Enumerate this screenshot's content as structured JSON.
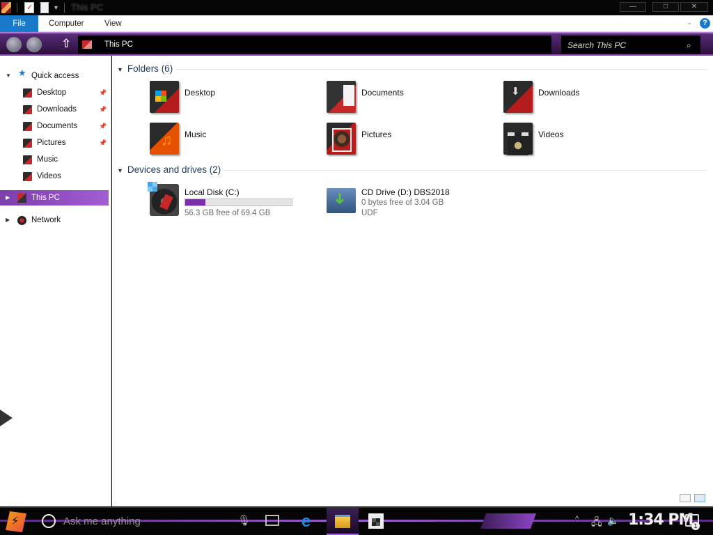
{
  "window": {
    "title": "This PC",
    "controls": {
      "minimize": "—",
      "maximize": "□",
      "close": "✕"
    }
  },
  "ribbon": {
    "tabs": [
      {
        "label": "File",
        "active": true
      },
      {
        "label": "Computer",
        "active": false
      },
      {
        "label": "View",
        "active": false
      }
    ],
    "help": "?"
  },
  "address": {
    "path": "This PC",
    "search_placeholder": "Search This PC"
  },
  "navpane": {
    "quick_access": "Quick access",
    "items": [
      {
        "label": "Desktop",
        "pinned": true,
        "icon": "folder-icon"
      },
      {
        "label": "Downloads",
        "pinned": true,
        "icon": "folder-icon"
      },
      {
        "label": "Documents",
        "pinned": true,
        "icon": "folder-icon"
      },
      {
        "label": "Pictures",
        "pinned": true,
        "icon": "folder-icon"
      },
      {
        "label": "Music",
        "pinned": false,
        "icon": "folder-icon"
      },
      {
        "label": "Videos",
        "pinned": false,
        "icon": "folder-icon"
      }
    ],
    "this_pc": "This PC",
    "network": "Network"
  },
  "content": {
    "folders_header": "Folders (6)",
    "folders": [
      {
        "name": "Desktop",
        "icon": "desktop-folder-icon"
      },
      {
        "name": "Documents",
        "icon": "documents-folder-icon"
      },
      {
        "name": "Downloads",
        "icon": "downloads-folder-icon"
      },
      {
        "name": "Music",
        "icon": "music-folder-icon"
      },
      {
        "name": "Pictures",
        "icon": "pictures-folder-icon"
      },
      {
        "name": "Videos",
        "icon": "videos-folder-icon"
      }
    ],
    "drives_header": "Devices and drives (2)",
    "drives": [
      {
        "name": "Local Disk (C:)",
        "free": "56.3 GB free of 69.4 GB",
        "used_fraction": 0.19,
        "icon": "local-disk-icon"
      },
      {
        "name": "CD Drive (D:) DBS2018",
        "free": "0 bytes free of 3.04 GB",
        "fs": "UDF",
        "icon": "cd-drive-icon"
      }
    ]
  },
  "taskbar": {
    "search_placeholder": "Ask me anything",
    "time": "1:34 PM",
    "notification_count": "1"
  },
  "colors": {
    "accent_purple": "#7a2ea8",
    "file_tab_blue": "#1979ca"
  }
}
